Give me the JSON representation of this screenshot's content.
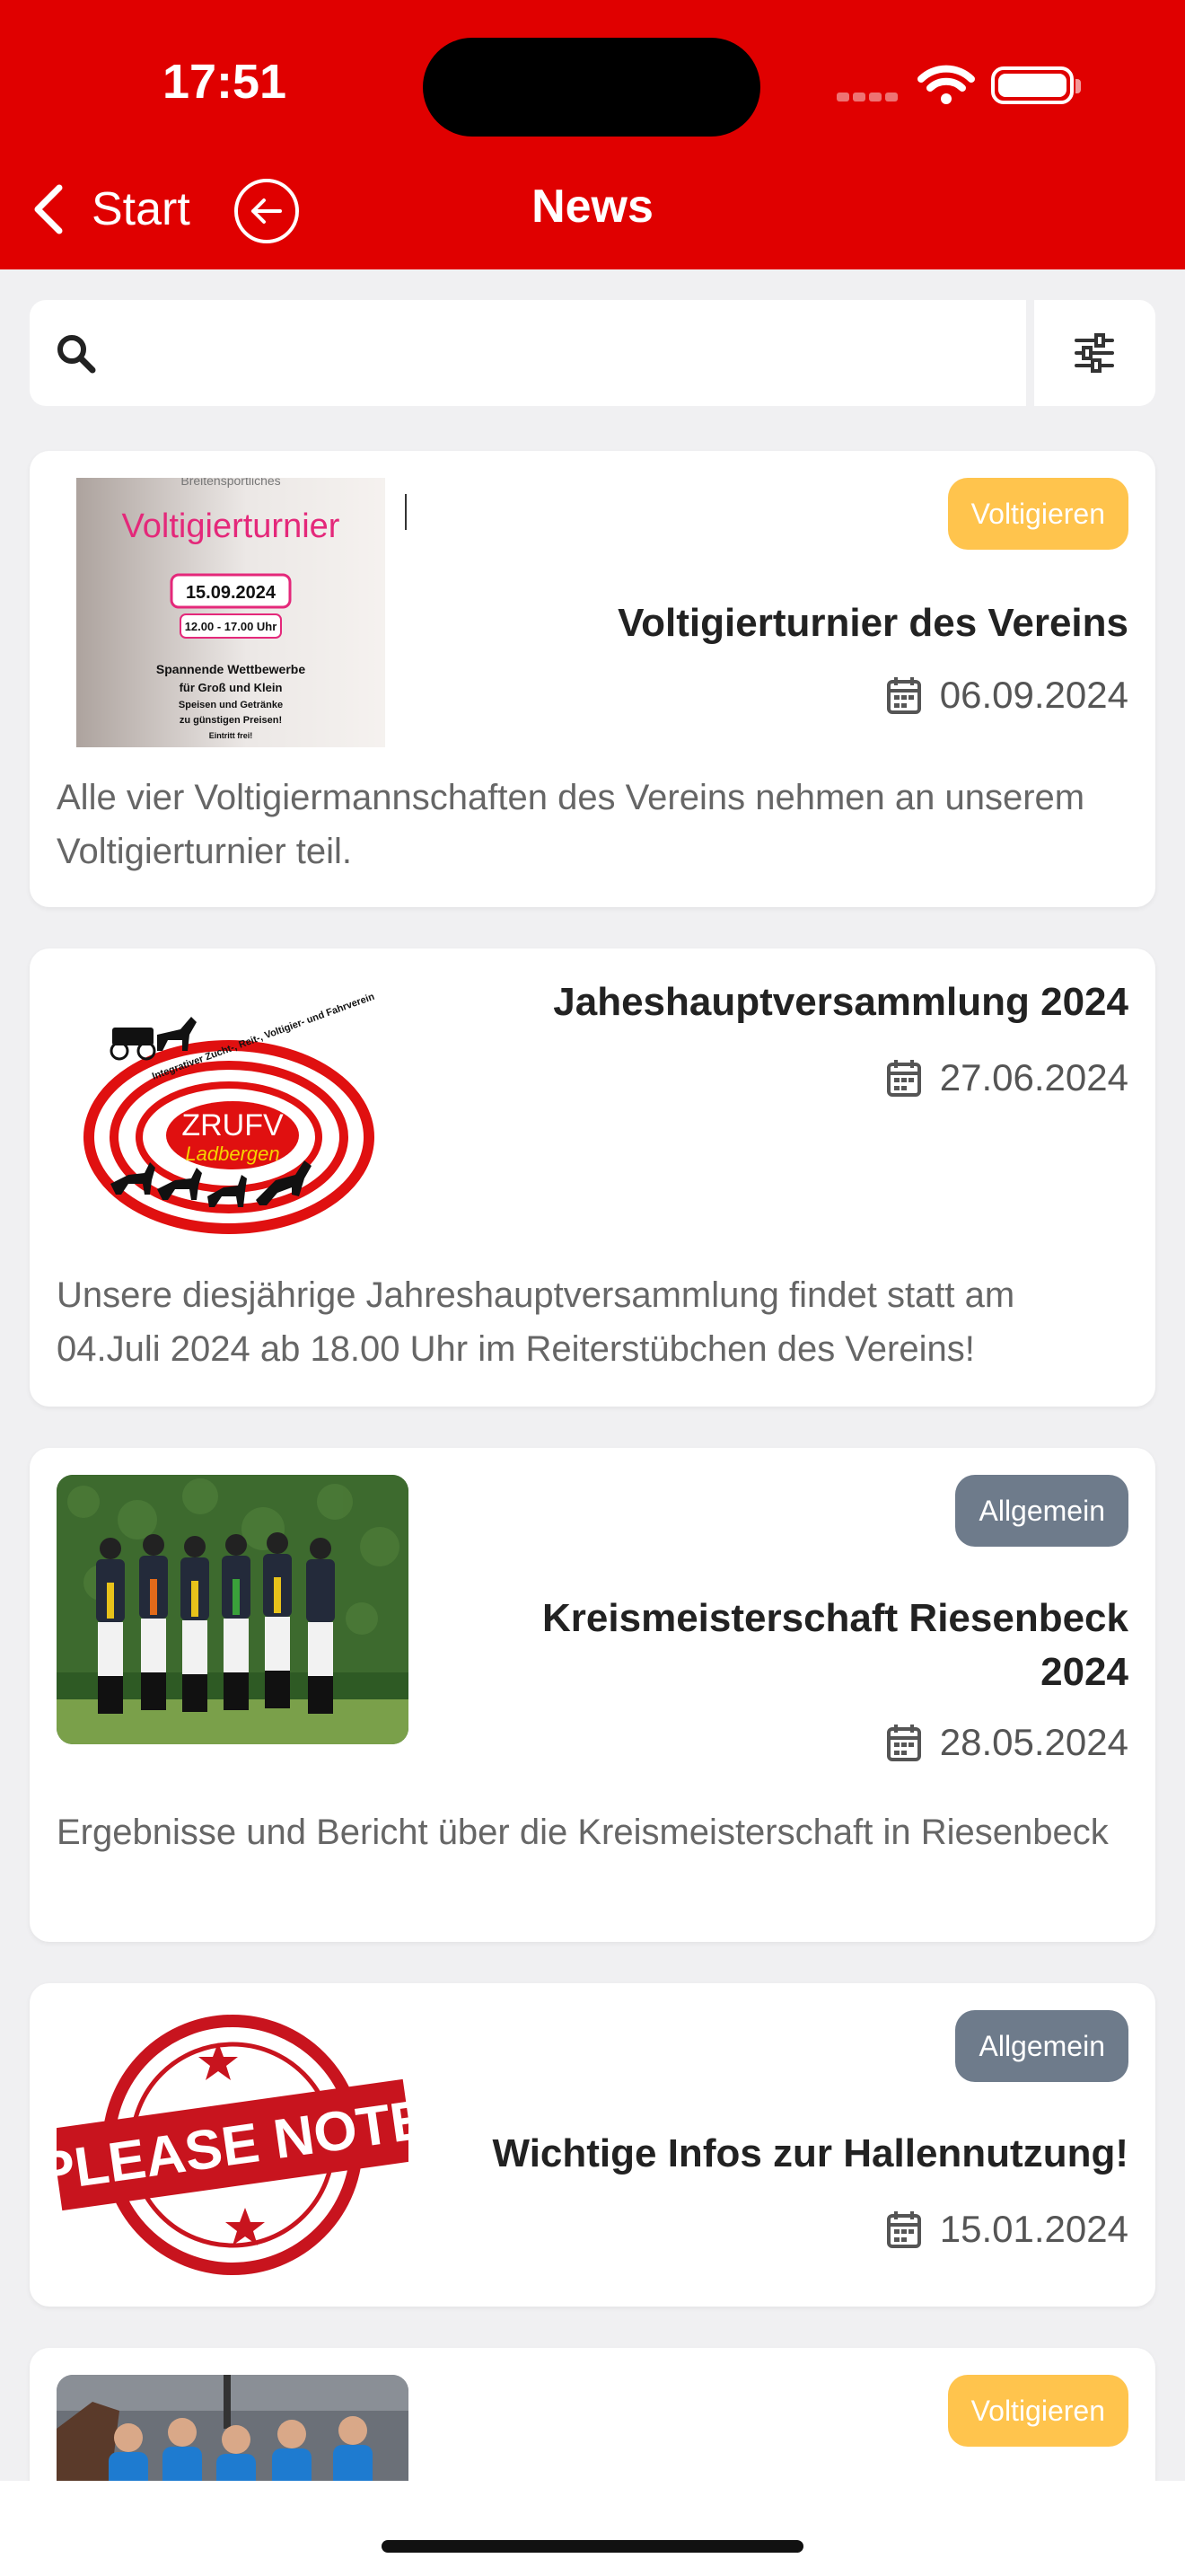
{
  "status": {
    "time": "17:51"
  },
  "nav": {
    "back_label": "Start",
    "title": "News"
  },
  "search": {
    "placeholder": "",
    "value": ""
  },
  "colors": {
    "brand_red": "#e00000",
    "badge_voltigieren": "#ffc44d",
    "badge_allgemein": "#6e7b8b"
  },
  "icons": {
    "back": "chevron-left-icon",
    "circle_back": "arrow-left-circle-icon",
    "search": "search-icon",
    "filter": "sliders-icon",
    "date": "calendar-icon"
  },
  "news": [
    {
      "title": "Voltigierturnier des Vereins",
      "date": "06.09.2024",
      "badge": "Voltigieren",
      "text": "Alle vier Voltigiermannschaften des Vereins nehmen an unserem Voltigierturnier teil.",
      "poster": {
        "top": "Breitensportliches",
        "heading": "Voltigierturnier",
        "date": "15.09.2024",
        "time": "12.00 - 17.00 Uhr",
        "line1": "Spannende Wettbewerbe",
        "line2": "für Groß und Klein",
        "line3": "Speisen und Getränke",
        "line4": "zu günstigen Preisen!",
        "line5": "Eintritt frei!"
      }
    },
    {
      "title": "Jaheshauptversammlung 2024",
      "date": "27.06.2024",
      "badge": "",
      "text": "Unsere diesjährige Jahreshauptversammlung findet statt  am 04.Juli 2024 ab 18.00 Uhr im Reiterstübchen des Vereins!",
      "logo": {
        "name": "ZRUFV",
        "sub": "Ladbergen",
        "arc": "Integrativer Zucht-, Reit-, Voltigier- und Fahrverein"
      }
    },
    {
      "title": "Kreismeisterschaft Riesenbeck 2024",
      "date": "28.05.2024",
      "badge": "Allgemein",
      "text": "Ergebnisse und Bericht über die Kreismeisterschaft in Riesenbeck"
    },
    {
      "title": "Wichtige Infos zur Hallennutzung!",
      "date": "15.01.2024",
      "badge": "Allgemein",
      "text": "",
      "stamp": "PLEASE NOTE"
    },
    {
      "title": "",
      "date": "",
      "badge": "Voltigieren",
      "text": ""
    }
  ]
}
